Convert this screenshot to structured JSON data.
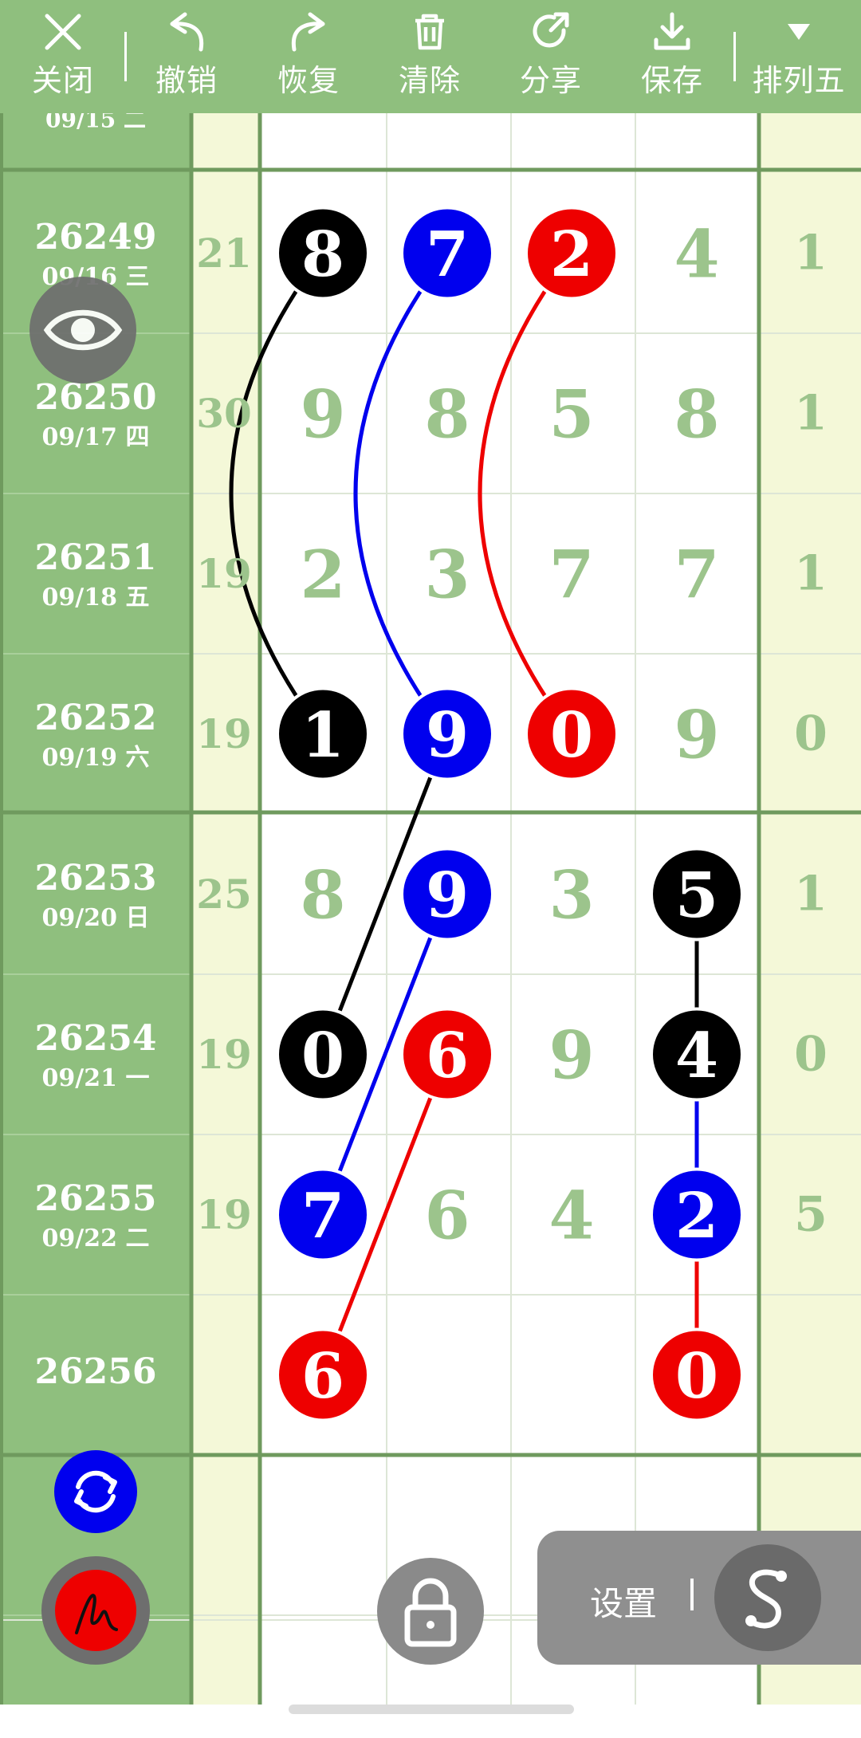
{
  "toolbar": {
    "close_label": "关闭",
    "undo_label": "撤销",
    "redo_label": "恢复",
    "clear_label": "清除",
    "share_label": "分享",
    "save_label": "保存",
    "lottery_label": "排列五"
  },
  "grid": {
    "partial_date": "09/15 二",
    "rows": [
      {
        "issue": "26249",
        "date": "09/16 三",
        "sum": "21",
        "digits": [
          "8",
          "7",
          "2",
          "4"
        ],
        "last": "1"
      },
      {
        "issue": "26250",
        "date": "09/17 四",
        "sum": "30",
        "digits": [
          "9",
          "8",
          "5",
          "8"
        ],
        "last": "1"
      },
      {
        "issue": "26251",
        "date": "09/18 五",
        "sum": "19",
        "digits": [
          "2",
          "3",
          "7",
          "7"
        ],
        "last": "1"
      },
      {
        "issue": "26252",
        "date": "09/19 六",
        "sum": "19",
        "digits": [
          "1",
          "9",
          "0",
          "9"
        ],
        "last": "0"
      },
      {
        "issue": "26253",
        "date": "09/20 日",
        "sum": "25",
        "digits": [
          "8",
          "9",
          "3",
          "5"
        ],
        "last": "1"
      },
      {
        "issue": "26254",
        "date": "09/21 一",
        "sum": "19",
        "digits": [
          "0",
          "6",
          "9",
          "4"
        ],
        "last": "0"
      },
      {
        "issue": "26255",
        "date": "09/22 二",
        "sum": "19",
        "digits": [
          "7",
          "6",
          "4",
          "2"
        ],
        "last": "5"
      },
      {
        "issue": "26256",
        "date": "",
        "sum": "",
        "digits": [
          "6",
          "",
          "",
          "0"
        ],
        "last": ""
      }
    ],
    "highlights": [
      {
        "row": 0,
        "col": 0,
        "color": "black"
      },
      {
        "row": 0,
        "col": 1,
        "color": "blue"
      },
      {
        "row": 0,
        "col": 2,
        "color": "red"
      },
      {
        "row": 3,
        "col": 0,
        "color": "black"
      },
      {
        "row": 3,
        "col": 1,
        "color": "blue"
      },
      {
        "row": 3,
        "col": 2,
        "color": "red"
      },
      {
        "row": 4,
        "col": 1,
        "color": "blue"
      },
      {
        "row": 4,
        "col": 3,
        "color": "black"
      },
      {
        "row": 5,
        "col": 0,
        "color": "black"
      },
      {
        "row": 5,
        "col": 1,
        "color": "red"
      },
      {
        "row": 5,
        "col": 3,
        "color": "black"
      },
      {
        "row": 6,
        "col": 0,
        "color": "blue"
      },
      {
        "row": 6,
        "col": 3,
        "color": "blue"
      },
      {
        "row": 7,
        "col": 0,
        "color": "red"
      },
      {
        "row": 7,
        "col": 3,
        "color": "red"
      }
    ],
    "connectors": [
      {
        "from": [
          0,
          0
        ],
        "to": [
          3,
          0
        ],
        "color": "black",
        "curved": true
      },
      {
        "from": [
          0,
          1
        ],
        "to": [
          3,
          1
        ],
        "color": "blue",
        "curved": true
      },
      {
        "from": [
          0,
          2
        ],
        "to": [
          3,
          2
        ],
        "color": "red",
        "curved": true
      },
      {
        "from": [
          3,
          1
        ],
        "to": [
          5,
          0
        ],
        "color": "black",
        "curved": false
      },
      {
        "from": [
          4,
          1
        ],
        "to": [
          6,
          0
        ],
        "color": "blue",
        "curved": false
      },
      {
        "from": [
          5,
          1
        ],
        "to": [
          7,
          0
        ],
        "color": "red",
        "curved": false
      },
      {
        "from": [
          4,
          3
        ],
        "to": [
          5,
          3
        ],
        "color": "black",
        "curved": false
      },
      {
        "from": [
          5,
          3
        ],
        "to": [
          6,
          3
        ],
        "color": "blue",
        "curved": false
      },
      {
        "from": [
          6,
          3
        ],
        "to": [
          7,
          3
        ],
        "color": "red",
        "curved": false
      }
    ]
  },
  "settings_label": "设置",
  "colors": {
    "header_green": "#8fbf7e",
    "issue_column": "#8fbf7e",
    "digit_green": "#9cc48c",
    "pale_yellow": "#f4f8d8",
    "grid_border": "#6f9a5e",
    "black": "#000000",
    "blue": "#0000ee",
    "red": "#ee0000"
  },
  "icons": [
    "close-icon",
    "undo-icon",
    "redo-icon",
    "trash-icon",
    "share-icon",
    "download-icon",
    "dropdown-arrow-icon",
    "eye-icon",
    "refresh-icon",
    "pen-icon",
    "lock-icon",
    "s-curve-icon"
  ]
}
